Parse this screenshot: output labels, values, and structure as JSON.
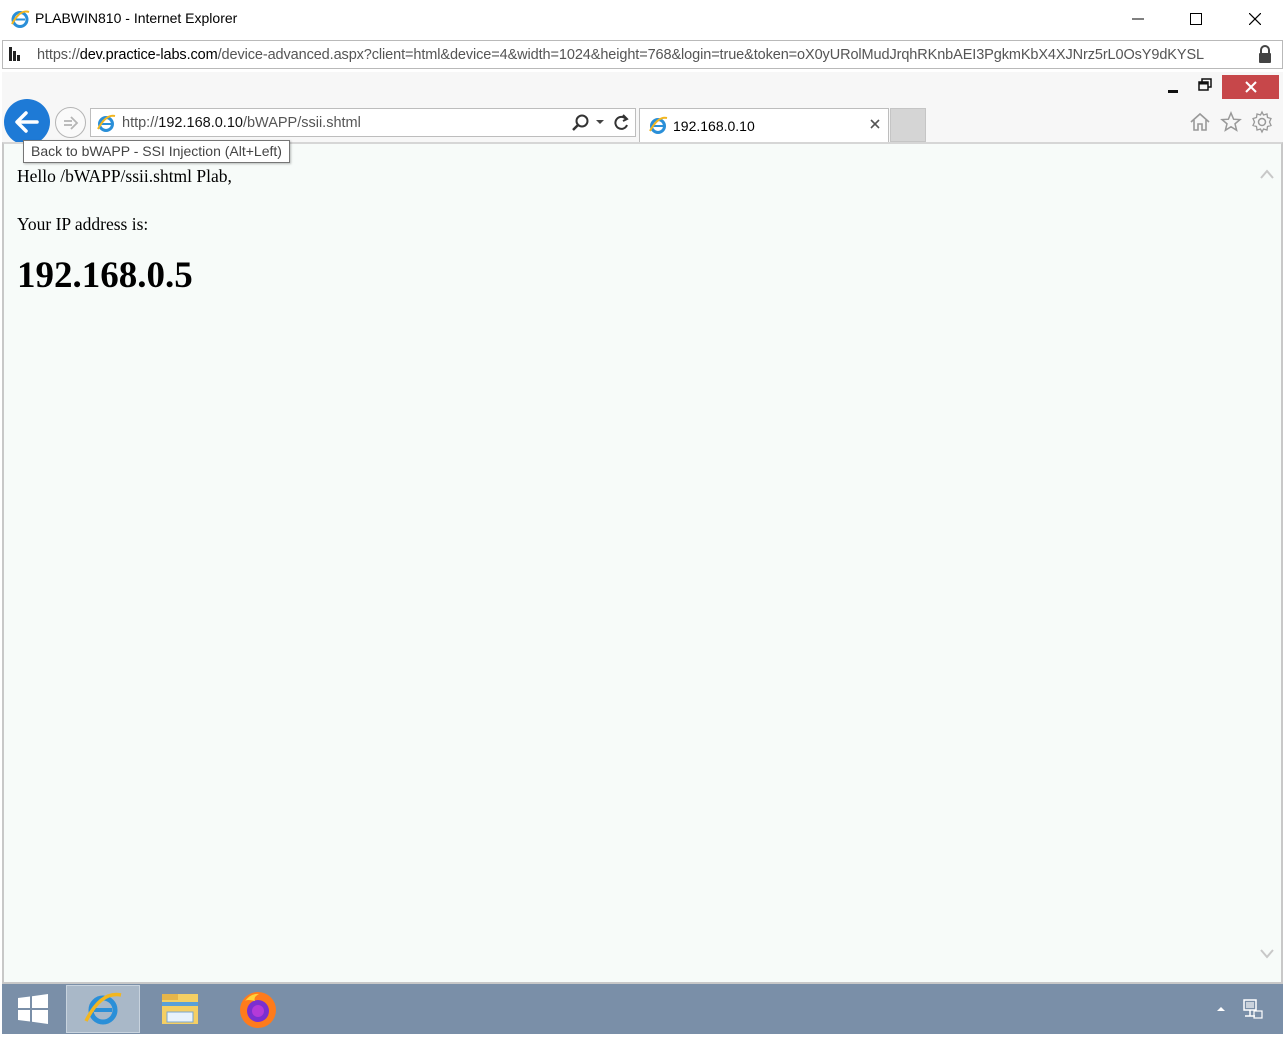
{
  "outer_window": {
    "title": "PLABWIN810 - Internet Explorer",
    "address_prefix": "https://",
    "address_domain": "dev.practice-labs.com",
    "address_rest": "/device-advanced.aspx?client=html&device=4&width=1024&height=768&login=true&token=oX0yURolMudJrqhRKnbAEI3PgkmKbX4XJNrz5rL0OsY9dKYSL"
  },
  "inner_browser": {
    "address_prefix": "http://",
    "address_host": "192.168.0.10",
    "address_path": "/bWAPP/ssii.shtml",
    "tab_title": "192.168.0.10",
    "back_tooltip": "Back to bWAPP - SSI Injection (Alt+Left)",
    "close_color": "#c7474a",
    "back_button_color": "#1e7ad6"
  },
  "page": {
    "hello_line": "Hello /bWAPP/ssii.shtml Plab,",
    "ip_label": "Your IP address is:",
    "ip_value": "192.168.0.5"
  },
  "taskbar": {
    "items": [
      "windows-start-icon",
      "internet-explorer-icon",
      "file-explorer-icon",
      "firefox-icon"
    ],
    "tray": [
      "show-hidden-icons-chevron",
      "network-icon"
    ],
    "color": "#7a8fa8"
  }
}
